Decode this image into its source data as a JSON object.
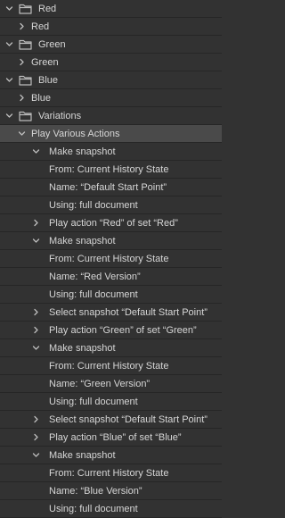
{
  "actions_panel": {
    "rows": [
      {
        "label": "Red",
        "kind": "set",
        "expanded": true,
        "icon": "folder-icon"
      },
      {
        "label": "Red",
        "kind": "action",
        "expanded": false
      },
      {
        "label": "Green",
        "kind": "set",
        "expanded": true,
        "icon": "folder-icon"
      },
      {
        "label": "Green",
        "kind": "action",
        "expanded": false
      },
      {
        "label": "Blue",
        "kind": "set",
        "expanded": true,
        "icon": "folder-icon"
      },
      {
        "label": "Blue",
        "kind": "action",
        "expanded": false
      },
      {
        "label": "Variations",
        "kind": "set",
        "expanded": true,
        "icon": "folder-icon"
      },
      {
        "label": "Play Various Actions",
        "kind": "action",
        "expanded": true,
        "selected": true
      },
      {
        "label": "Make snapshot",
        "kind": "command",
        "expanded": true
      },
      {
        "label": "From: Current History State",
        "kind": "detail"
      },
      {
        "label": "Name:  “Default Start Point”",
        "kind": "detail"
      },
      {
        "label": "Using: full document",
        "kind": "detail"
      },
      {
        "label": "Play action “Red” of set “Red”",
        "kind": "command"
      },
      {
        "label": "Make snapshot",
        "kind": "command",
        "expanded": true
      },
      {
        "label": "From: Current History State",
        "kind": "detail"
      },
      {
        "label": "Name:  “Red Version”",
        "kind": "detail"
      },
      {
        "label": "Using: full document",
        "kind": "detail"
      },
      {
        "label": "Select snapshot “Default Start Point”",
        "kind": "command"
      },
      {
        "label": "Play action “Green” of set “Green”",
        "kind": "command"
      },
      {
        "label": "Make snapshot",
        "kind": "command",
        "expanded": true
      },
      {
        "label": "From: Current History State",
        "kind": "detail"
      },
      {
        "label": "Name:  “Green Version”",
        "kind": "detail"
      },
      {
        "label": "Using: full document",
        "kind": "detail"
      },
      {
        "label": "Select snapshot “Default Start Point”",
        "kind": "command"
      },
      {
        "label": "Play action “Blue” of set “Blue”",
        "kind": "command"
      },
      {
        "label": "Make snapshot",
        "kind": "command",
        "expanded": true
      },
      {
        "label": "From: Current History State",
        "kind": "detail"
      },
      {
        "label": "Name:  “Blue Version”",
        "kind": "detail"
      },
      {
        "label": "Using: full document",
        "kind": "detail"
      }
    ]
  },
  "colors": {
    "panel_bg": "#323232",
    "row_divider": "#262626",
    "selected_bg": "#4a4a4a",
    "text": "#d6d6d6",
    "icon": "#bdbdbd"
  }
}
